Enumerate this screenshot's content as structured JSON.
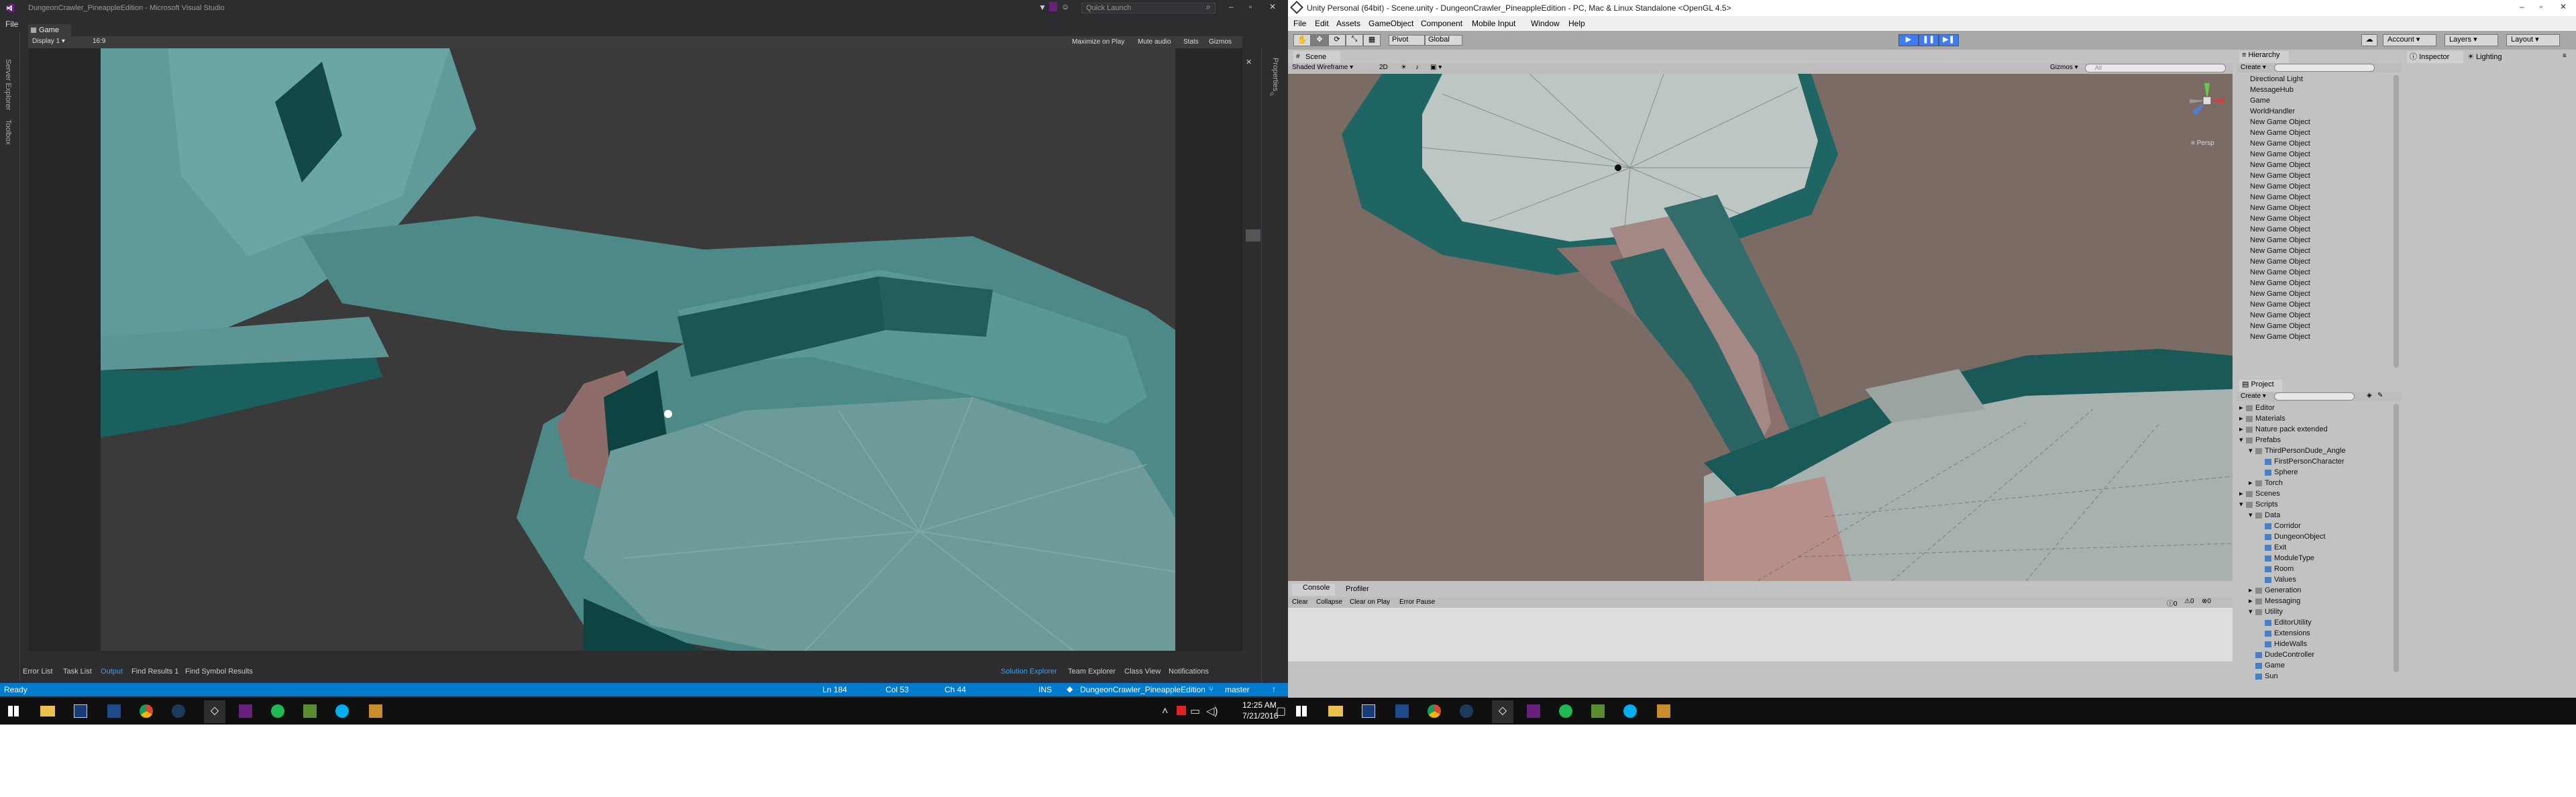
{
  "vs": {
    "title": "DungeonCrawler_PineappleEdition - Microsoft Visual Studio",
    "quick_launch_placeholder": "Quick Launch",
    "menu": [
      "File"
    ],
    "game_tab": "Game",
    "display": "Display 1",
    "aspect": "16:9",
    "game_toolbar": [
      "Maximize on Play",
      "Mute audio",
      "Stats",
      "Gizmos"
    ],
    "left_dock": [
      "Server Explorer",
      "Toolbox"
    ],
    "right_dock": [
      "Properties"
    ],
    "output_tabs": [
      "Error List",
      "Task List",
      "Output",
      "Find Results 1",
      "Find Symbol Results"
    ],
    "solution_tabs": [
      "Solution Explorer",
      "Team Explorer",
      "Class View",
      "Notifications"
    ],
    "status": {
      "ready": "Ready",
      "ln": "Ln 184",
      "col": "Col 53",
      "ch": "Ch 44",
      "ins": "INS",
      "project": "DungeonCrawler_PineappleEdition",
      "branch": "master"
    }
  },
  "unity": {
    "title": "Unity Personal (64bit) - Scene.unity - DungeonCrawler_PineappleEdition - PC, Mac & Linux Standalone <OpenGL 4.5>",
    "menu": [
      "File",
      "Edit",
      "Assets",
      "GameObject",
      "Component",
      "Mobile Input",
      "Window",
      "Help"
    ],
    "toolbar": {
      "pivot": "Pivot",
      "global": "Global",
      "account": "Account",
      "layers": "Layers",
      "layout": "Layout"
    },
    "scene_tab": "Scene",
    "scene_toolbar": {
      "shading": "Shaded Wireframe",
      "mode": "2D",
      "gizmos": "Gizmos",
      "search_placeholder": "All"
    },
    "persp_label": "Persp",
    "hierarchy": {
      "tab": "Hierarchy",
      "create": "Create",
      "items": [
        "Directional Light",
        "MessageHub",
        "Game",
        "WorldHandler",
        "New Game Object",
        "New Game Object",
        "New Game Object",
        "New Game Object",
        "New Game Object",
        "New Game Object",
        "New Game Object",
        "New Game Object",
        "New Game Object",
        "New Game Object",
        "New Game Object",
        "New Game Object",
        "New Game Object",
        "New Game Object",
        "New Game Object",
        "New Game Object",
        "New Game Object",
        "New Game Object",
        "New Game Object",
        "New Game Object",
        "New Game Object"
      ]
    },
    "project": {
      "tab": "Project",
      "create": "Create",
      "tree": [
        {
          "label": "Editor",
          "indent": 0,
          "toggle": "▸"
        },
        {
          "label": "Materials",
          "indent": 0,
          "toggle": "▸"
        },
        {
          "label": "Nature pack extended",
          "indent": 0,
          "toggle": "▸"
        },
        {
          "label": "Prefabs",
          "indent": 0,
          "toggle": "▾"
        },
        {
          "label": "ThirdPersonDude_Angle",
          "indent": 1,
          "toggle": "▾"
        },
        {
          "label": "FirstPersonCharacter",
          "indent": 2,
          "toggle": ""
        },
        {
          "label": "Sphere",
          "indent": 2,
          "toggle": ""
        },
        {
          "label": "Torch",
          "indent": 1,
          "toggle": "▸"
        },
        {
          "label": "Scenes",
          "indent": 0,
          "toggle": "▸"
        },
        {
          "label": "Scripts",
          "indent": 0,
          "toggle": "▾"
        },
        {
          "label": "Data",
          "indent": 1,
          "toggle": "▾"
        },
        {
          "label": "Corridor",
          "indent": 2,
          "toggle": ""
        },
        {
          "label": "DungeonObject",
          "indent": 2,
          "toggle": ""
        },
        {
          "label": "Exit",
          "indent": 2,
          "toggle": ""
        },
        {
          "label": "ModuleType",
          "indent": 2,
          "toggle": ""
        },
        {
          "label": "Room",
          "indent": 2,
          "toggle": ""
        },
        {
          "label": "Values",
          "indent": 2,
          "toggle": ""
        },
        {
          "label": "Generation",
          "indent": 1,
          "toggle": "▸"
        },
        {
          "label": "Messaging",
          "indent": 1,
          "toggle": "▸"
        },
        {
          "label": "Utility",
          "indent": 1,
          "toggle": "▾"
        },
        {
          "label": "EditorUtility",
          "indent": 2,
          "toggle": ""
        },
        {
          "label": "Extensions",
          "indent": 2,
          "toggle": ""
        },
        {
          "label": "HideWalls",
          "indent": 2,
          "toggle": ""
        },
        {
          "label": "DudeController",
          "indent": 1,
          "toggle": ""
        },
        {
          "label": "Game",
          "indent": 1,
          "toggle": ""
        },
        {
          "label": "Sun",
          "indent": 1,
          "toggle": ""
        }
      ]
    },
    "inspector": {
      "tab": "Inspector",
      "lighting_tab": "Lighting"
    },
    "console": {
      "tab": "Console",
      "profiler_tab": "Profiler",
      "buttons": [
        "Clear",
        "Collapse",
        "Clear on Play",
        "Error Pause"
      ]
    }
  },
  "taskbar": {
    "time": "12:25 AM",
    "date": "7/21/2016"
  }
}
